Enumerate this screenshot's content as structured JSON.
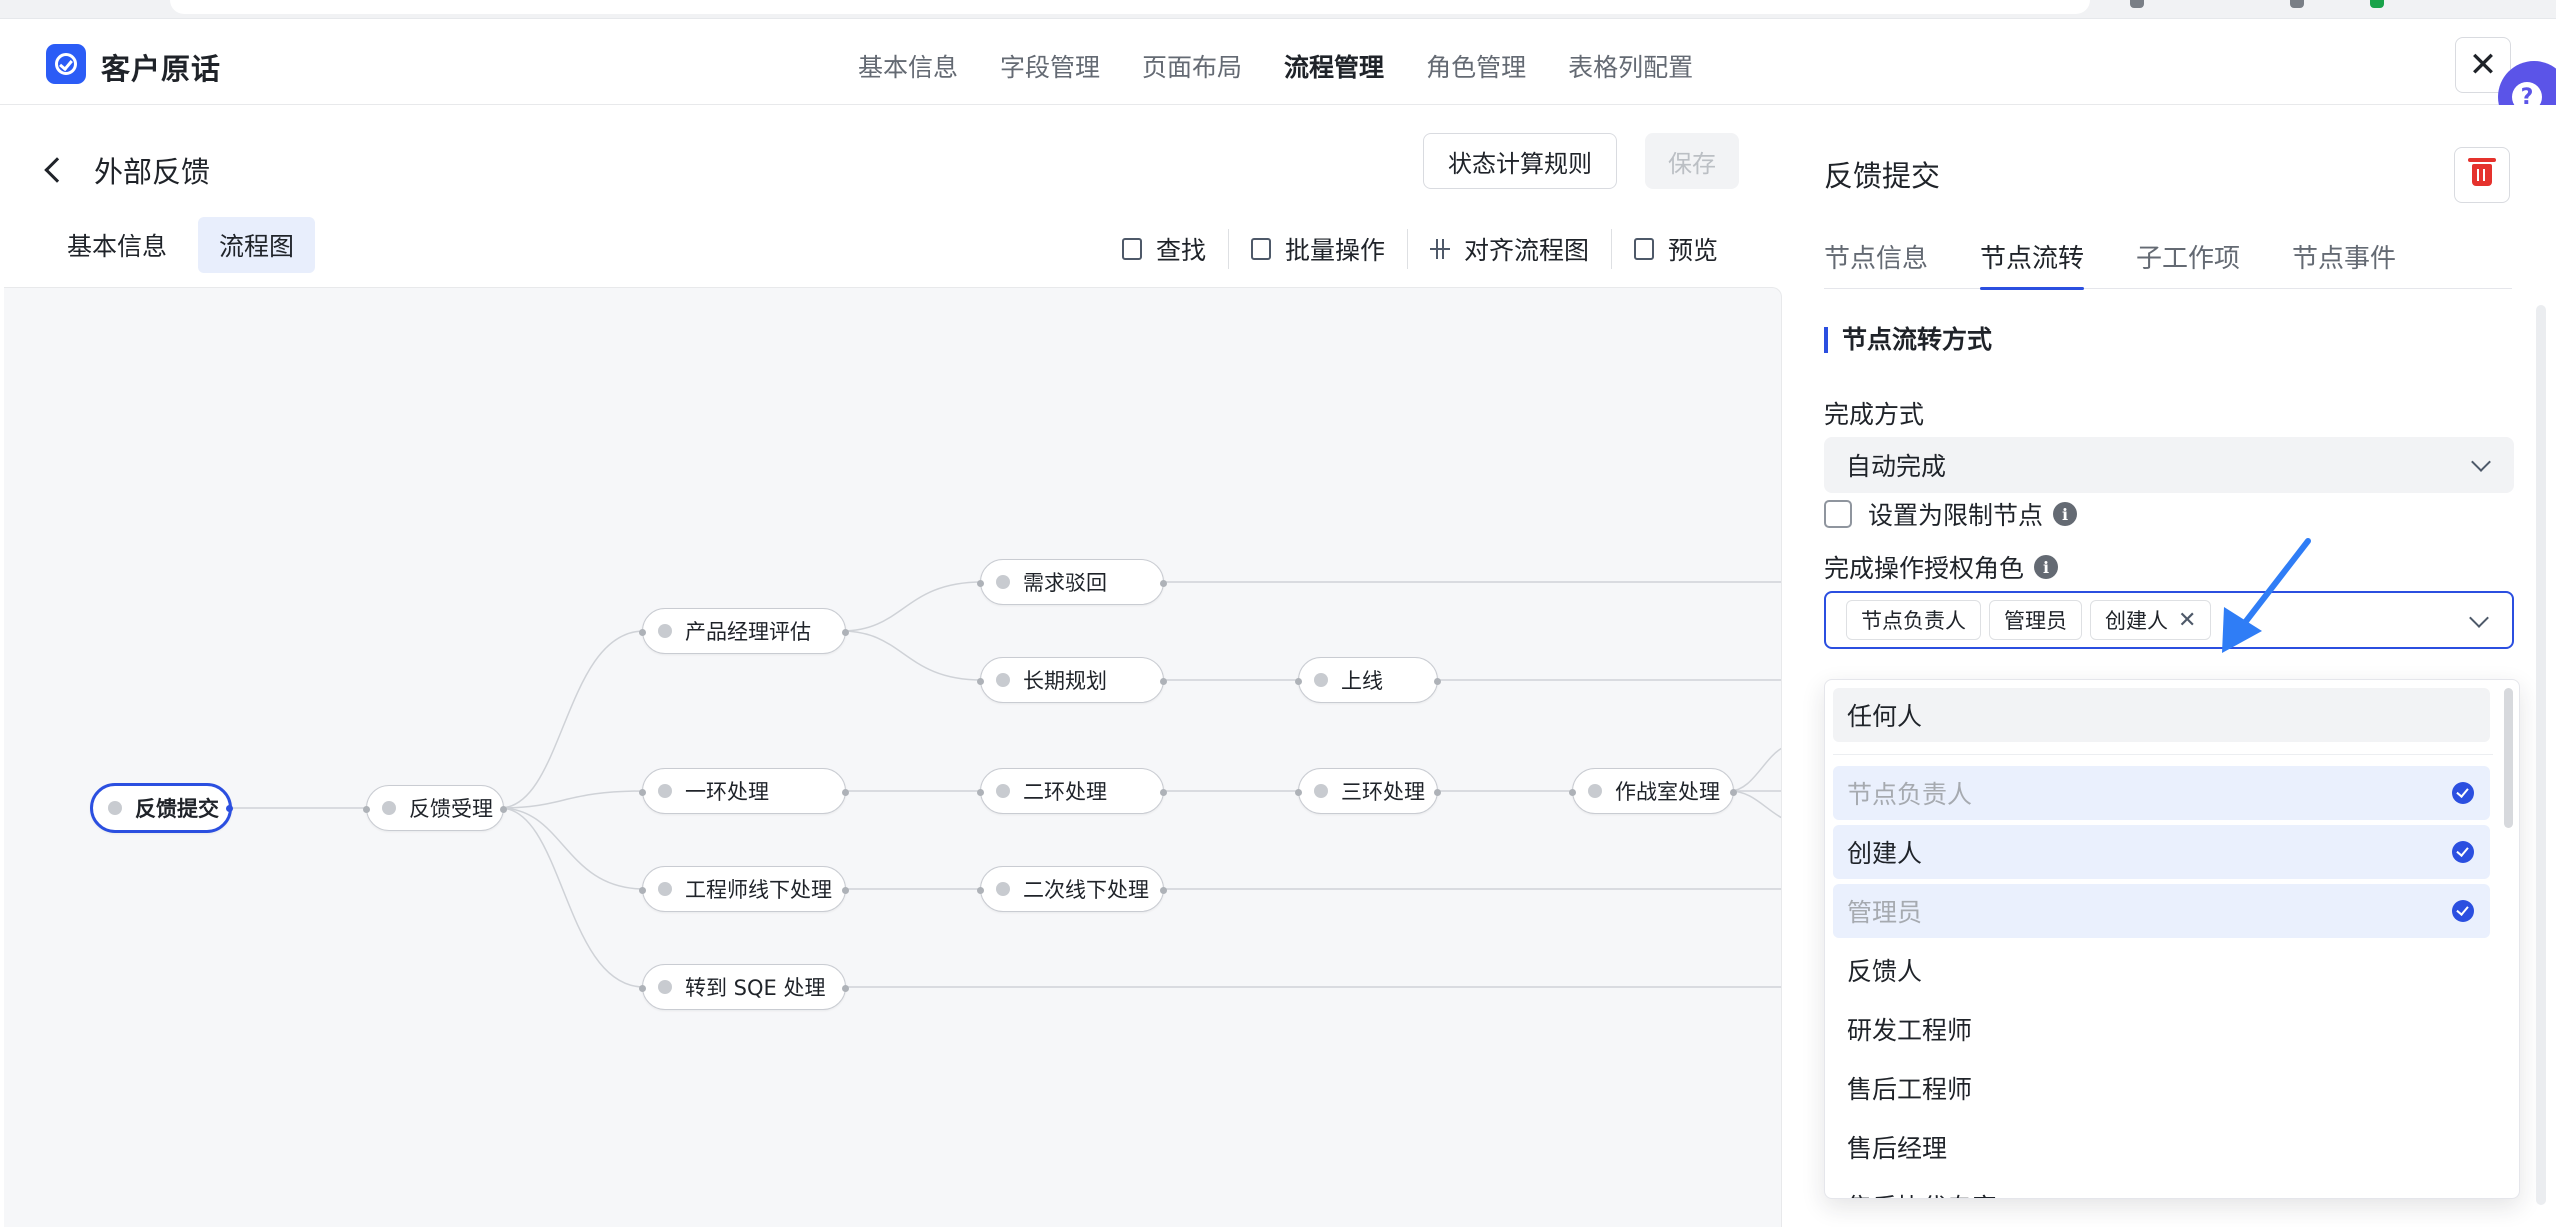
{
  "app": {
    "name": "客户原话"
  },
  "top_nav": [
    "基本信息",
    "字段管理",
    "页面布局",
    "流程管理",
    "角色管理",
    "表格列配置"
  ],
  "top_nav_active": "流程管理",
  "workflow": {
    "title": "外部反馈",
    "rules_button": "状态计算规则",
    "save_button": "保存",
    "sub_tabs": [
      "基本信息",
      "流程图"
    ],
    "toolbar": [
      "查找",
      "批量操作",
      "对齐流程图",
      "预览"
    ]
  },
  "flow_nodes": {
    "feedback_submit": "反馈提交",
    "feedback_accept": "反馈受理",
    "pm_eval": "产品经理评估",
    "first_ring": "一环处理",
    "engineer_offline": "工程师线下处理",
    "to_sqe": "转到 SQE 处理",
    "req_reject": "需求驳回",
    "long_term": "长期规划",
    "go_live": "上线",
    "second_ring": "二环处理",
    "third_ring": "三环处理",
    "war_room": "作战室处理",
    "second_offline": "二次线下处理"
  },
  "panel": {
    "title": "反馈提交",
    "tabs": [
      "节点信息",
      "节点流转",
      "子工作项",
      "节点事件"
    ],
    "active_tab": "节点流转",
    "section_title": "节点流转方式",
    "completion_label": "完成方式",
    "completion_value": "自动完成",
    "restrict_label": "设置为限制节点",
    "roles_label": "完成操作授权角色",
    "selected_roles": [
      "节点负责人",
      "管理员",
      "创建人"
    ],
    "dropdown": {
      "any": "任何人",
      "items": [
        {
          "label": "节点负责人",
          "selected": true,
          "disabled": true
        },
        {
          "label": "创建人",
          "selected": true,
          "disabled": false
        },
        {
          "label": "管理员",
          "selected": true,
          "disabled": true
        },
        {
          "label": "反馈人",
          "selected": false,
          "disabled": false
        },
        {
          "label": "研发工程师",
          "selected": false,
          "disabled": false
        },
        {
          "label": "售后工程师",
          "selected": false,
          "disabled": false
        },
        {
          "label": "售后经理",
          "selected": false,
          "disabled": false
        },
        {
          "label": "售后协代专家",
          "selected": false,
          "disabled": false
        }
      ]
    }
  },
  "colors": {
    "accent": "#2b4fe0",
    "danger": "#e5322d",
    "help": "#5b54e8",
    "annotation_arrow": "#2f7df6"
  }
}
